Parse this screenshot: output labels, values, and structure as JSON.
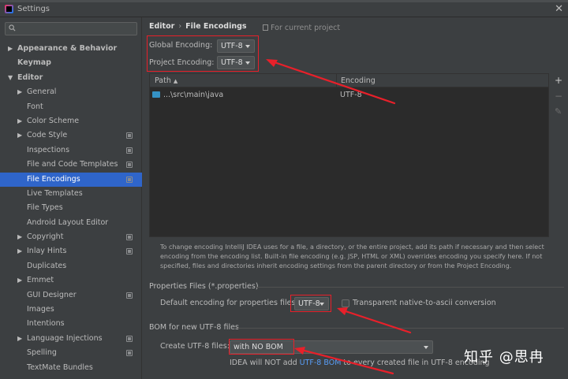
{
  "window": {
    "title": "Settings"
  },
  "sidebar": {
    "items": [
      {
        "label": "Appearance & Behavior",
        "level": 0,
        "expand": "collapsed",
        "bold": true,
        "project": false,
        "selected": false
      },
      {
        "label": "Keymap",
        "level": 0,
        "expand": "none",
        "bold": true,
        "project": false,
        "selected": false
      },
      {
        "label": "Editor",
        "level": 0,
        "expand": "expanded",
        "bold": true,
        "project": false,
        "selected": false
      },
      {
        "label": "General",
        "level": 1,
        "expand": "collapsed",
        "bold": false,
        "project": false,
        "selected": false
      },
      {
        "label": "Font",
        "level": 1,
        "expand": "none",
        "bold": false,
        "project": false,
        "selected": false
      },
      {
        "label": "Color Scheme",
        "level": 1,
        "expand": "collapsed",
        "bold": false,
        "project": false,
        "selected": false
      },
      {
        "label": "Code Style",
        "level": 1,
        "expand": "collapsed",
        "bold": false,
        "project": true,
        "selected": false
      },
      {
        "label": "Inspections",
        "level": 1,
        "expand": "none",
        "bold": false,
        "project": true,
        "selected": false
      },
      {
        "label": "File and Code Templates",
        "level": 1,
        "expand": "none",
        "bold": false,
        "project": true,
        "selected": false
      },
      {
        "label": "File Encodings",
        "level": 1,
        "expand": "none",
        "bold": false,
        "project": true,
        "selected": true
      },
      {
        "label": "Live Templates",
        "level": 1,
        "expand": "none",
        "bold": false,
        "project": false,
        "selected": false
      },
      {
        "label": "File Types",
        "level": 1,
        "expand": "none",
        "bold": false,
        "project": false,
        "selected": false
      },
      {
        "label": "Android Layout Editor",
        "level": 1,
        "expand": "none",
        "bold": false,
        "project": false,
        "selected": false
      },
      {
        "label": "Copyright",
        "level": 1,
        "expand": "collapsed",
        "bold": false,
        "project": true,
        "selected": false
      },
      {
        "label": "Inlay Hints",
        "level": 1,
        "expand": "collapsed",
        "bold": false,
        "project": true,
        "selected": false
      },
      {
        "label": "Duplicates",
        "level": 1,
        "expand": "none",
        "bold": false,
        "project": false,
        "selected": false
      },
      {
        "label": "Emmet",
        "level": 1,
        "expand": "collapsed",
        "bold": false,
        "project": false,
        "selected": false
      },
      {
        "label": "GUI Designer",
        "level": 1,
        "expand": "none",
        "bold": false,
        "project": true,
        "selected": false
      },
      {
        "label": "Images",
        "level": 1,
        "expand": "none",
        "bold": false,
        "project": false,
        "selected": false
      },
      {
        "label": "Intentions",
        "level": 1,
        "expand": "none",
        "bold": false,
        "project": false,
        "selected": false
      },
      {
        "label": "Language Injections",
        "level": 1,
        "expand": "collapsed",
        "bold": false,
        "project": true,
        "selected": false
      },
      {
        "label": "Spelling",
        "level": 1,
        "expand": "none",
        "bold": false,
        "project": true,
        "selected": false
      },
      {
        "label": "TextMate Bundles",
        "level": 1,
        "expand": "none",
        "bold": false,
        "project": false,
        "selected": false
      }
    ]
  },
  "breadcrumb": {
    "parent": "Editor",
    "separator": "›",
    "current": "File Encodings",
    "note": "For current project"
  },
  "encodings": {
    "global_label": "Global Encoding:",
    "global_value": "UTF-8",
    "project_label": "Project Encoding:",
    "project_value": "UTF-8"
  },
  "table": {
    "headers": {
      "path": "Path",
      "sort_glyph": "▲",
      "encoding": "Encoding"
    },
    "rows": [
      {
        "path": "...\\src\\main\\java",
        "encoding": "UTF-8"
      }
    ],
    "tools": {
      "add": "+",
      "remove": "−",
      "edit": "✎"
    }
  },
  "description": "To change encoding IntelliJ IDEA uses for a file, a directory, or the entire project, add its path if necessary and then select encoding from the encoding list. Built-in file encoding (e.g. JSP, HTML or XML) overrides encoding you specify here. If not specified, files and directories inherit encoding settings from the parent directory or from the Project Encoding.",
  "properties": {
    "section_title": "Properties Files (*.properties)",
    "default_label": "Default encoding for properties files:",
    "default_value": "UTF-8",
    "transparent_label": "Transparent native-to-ascii conversion",
    "transparent_checked": false
  },
  "bom": {
    "section_title": "BOM for new UTF-8 files",
    "create_label": "Create UTF-8 files:",
    "create_value": "with NO BOM",
    "note_before": "IDEA will NOT add ",
    "note_link": "UTF-8 BOM",
    "note_after": " to every created file in UTF-8 encoding"
  },
  "watermark": "知乎 @思冉",
  "colors": {
    "selection": "#2f65ca",
    "annotation": "#e8202a",
    "link": "#589df6",
    "folder": "#3592c4"
  }
}
